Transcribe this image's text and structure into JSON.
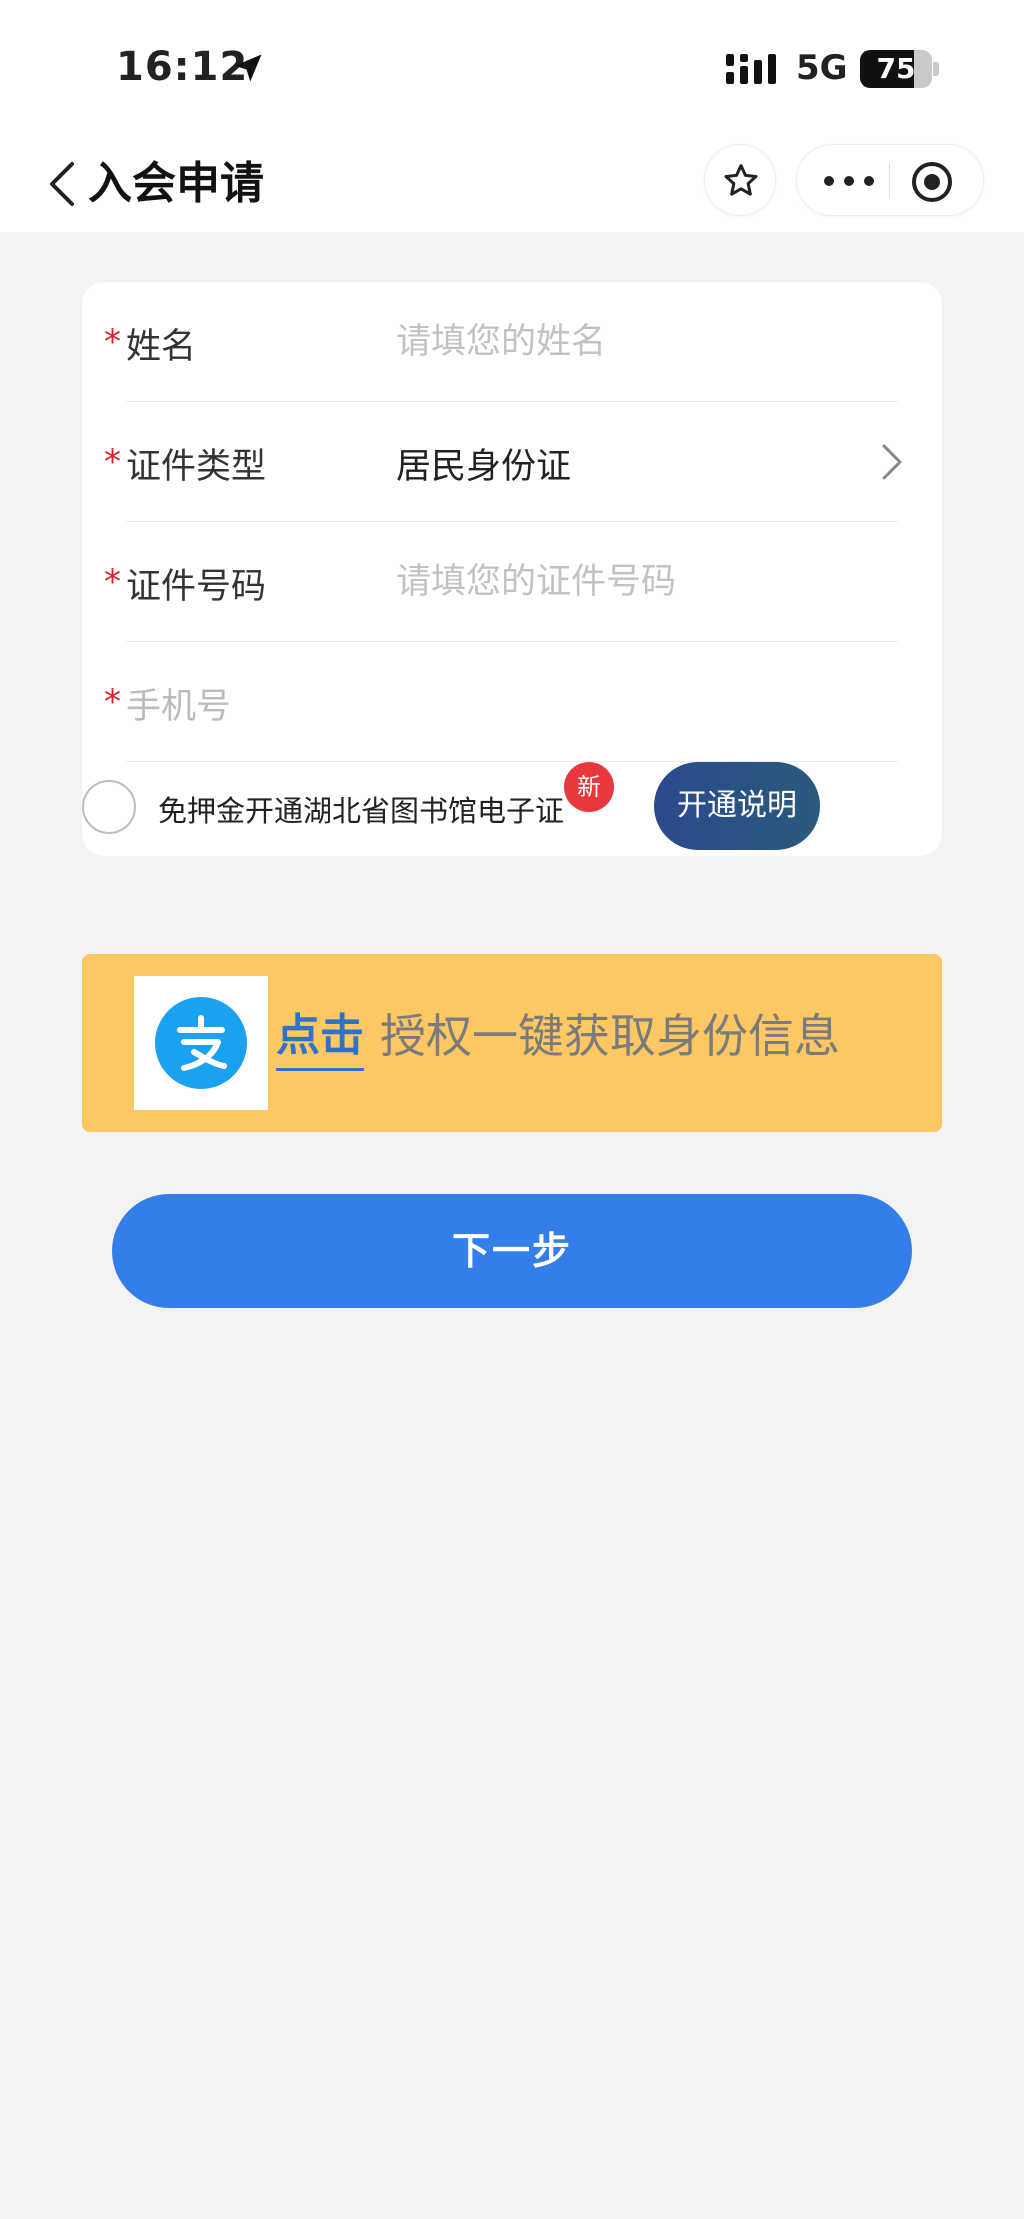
{
  "status_bar": {
    "time": "16:12",
    "network": "5G",
    "battery": "75",
    "battery_level": 0.75
  },
  "nav": {
    "title": "入会申请",
    "icons": [
      "back-icon",
      "star-icon",
      "more-icon",
      "close-miniprogram-icon"
    ]
  },
  "form": {
    "name": {
      "required_mark": "*",
      "label": "姓名",
      "placeholder": "请填您的姓名"
    },
    "id_type": {
      "required_mark": "*",
      "label": "证件类型",
      "value": "居民身份证"
    },
    "id_number": {
      "required_mark": "*",
      "label": "证件号码",
      "placeholder": "请填您的证件号码"
    },
    "phone": {
      "required_mark": "*",
      "label": "手机号"
    },
    "agreement": {
      "text": "免押金开通湖北省图书馆电子证",
      "badge": "新",
      "explain_button": "开通说明"
    }
  },
  "auth_banner": {
    "click_label": "点击",
    "text": "授权一键获取身份信息",
    "icon": "alipay-icon"
  },
  "next_button": "下一步",
  "colors": {
    "primary": "#337ee9",
    "banner": "#fdc863",
    "required": "#d0242c",
    "badge": "#e8383d"
  }
}
